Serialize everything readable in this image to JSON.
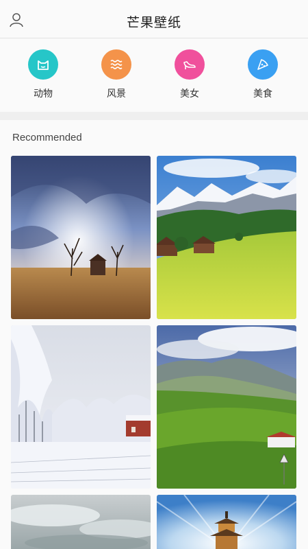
{
  "header": {
    "title": "芒果壁纸",
    "user_icon": "user-icon"
  },
  "categories": [
    {
      "label": "动物",
      "icon": "cat-face-icon",
      "color": "#26c6c8"
    },
    {
      "label": "风景",
      "icon": "waves-icon",
      "color": "#f4934a"
    },
    {
      "label": "美女",
      "icon": "high-heel-icon",
      "color": "#f0509c"
    },
    {
      "label": "美食",
      "icon": "pizza-icon",
      "color": "#3aa0f2"
    }
  ],
  "section": {
    "title": "Recommended"
  },
  "wallpapers": [
    {
      "name": "stormy-field-house"
    },
    {
      "name": "alpine-meadow"
    },
    {
      "name": "snowy-forest-house"
    },
    {
      "name": "green-hills-house"
    },
    {
      "name": "cloudy-sky"
    },
    {
      "name": "pagoda-sky"
    }
  ]
}
